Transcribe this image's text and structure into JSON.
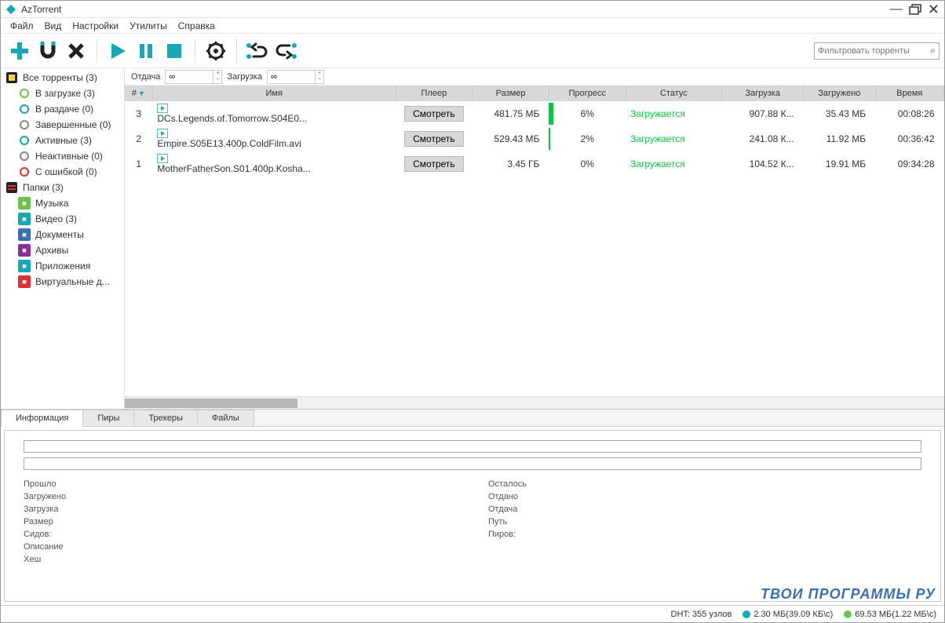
{
  "titlebar": {
    "title": "AzTorrent"
  },
  "menubar": [
    "Файл",
    "Вид",
    "Настройки",
    "Утилиты",
    "Справка"
  ],
  "filter": {
    "placeholder": "Фильтровать торренты"
  },
  "speedbar": {
    "upload_label": "Отдача",
    "upload_value": "∞",
    "download_label": "Загрузка",
    "download_value": "∞"
  },
  "sidebar": {
    "all": {
      "label": "Все торренты (3)"
    },
    "states": [
      {
        "label": "В загрузке (3)",
        "color": "#6cc24a"
      },
      {
        "label": "В раздаче (0)",
        "color": "#17a8b8"
      },
      {
        "label": "Завершенные (0)",
        "color": "#888"
      },
      {
        "label": "Активные (3)",
        "color": "#17a8b8"
      },
      {
        "label": "Неактивные (0)",
        "color": "#888"
      },
      {
        "label": "С ошибкой (0)",
        "color": "#e03030"
      }
    ],
    "folders_label": "Папки (3)",
    "folders": [
      {
        "label": "Музыка",
        "color": "#6cc24a"
      },
      {
        "label": "Видео (3)",
        "color": "#17a8b8"
      },
      {
        "label": "Документы",
        "color": "#3b6fb5"
      },
      {
        "label": "Архивы",
        "color": "#8a2f9a"
      },
      {
        "label": "Приложения",
        "color": "#17a8b8"
      },
      {
        "label": "Виртуальные д...",
        "color": "#e03030"
      }
    ]
  },
  "columns": [
    "#",
    "Имя",
    "Плеер",
    "Размер",
    "Прогресс",
    "Статус",
    "Загрузка",
    "Загружено",
    "Время"
  ],
  "rows": [
    {
      "num": "3",
      "name": "DCs.Legends.of.Tomorrow.S04E0...",
      "player": "Смотреть",
      "size": "481.75 МБ",
      "progress": 6,
      "progress_txt": "6%",
      "status": "Загружается",
      "dl": "907.88 К...",
      "done": "35.43 МБ",
      "time": "00:08:26"
    },
    {
      "num": "2",
      "name": "Empire.S05E13.400p.ColdFilm.avi",
      "player": "Смотреть",
      "size": "529.43 МБ",
      "progress": 2,
      "progress_txt": "2%",
      "status": "Загружается",
      "dl": "241.08 К...",
      "done": "11.92 МБ",
      "time": "00:36:42"
    },
    {
      "num": "1",
      "name": "MotherFatherSon.S01.400p.Kosha...",
      "player": "Смотреть",
      "size": "3.45 ГБ",
      "progress": 0,
      "progress_txt": "0%",
      "status": "Загружается",
      "dl": "104.52 К...",
      "done": "19.91 МБ",
      "time": "09:34:28"
    }
  ],
  "detail_tabs": [
    "Информация",
    "Пиры",
    "Трекеры",
    "Файлы"
  ],
  "details": {
    "left": [
      "Прошло",
      "Загружено",
      "Загрузка",
      "Размер",
      "Сидов:",
      "Описание",
      "Хеш"
    ],
    "right": [
      "Осталось",
      "Отдано",
      "Отдача",
      "Путь",
      "Пиров:"
    ]
  },
  "statusbar": {
    "dht": "DHT: 355 узлов",
    "down": "2.30 МБ(39.09 КБ\\с)",
    "up": "69.53 МБ(1.22 МБ\\с)"
  },
  "watermark": "ТВОИ ПРОГРАММЫ РУ"
}
